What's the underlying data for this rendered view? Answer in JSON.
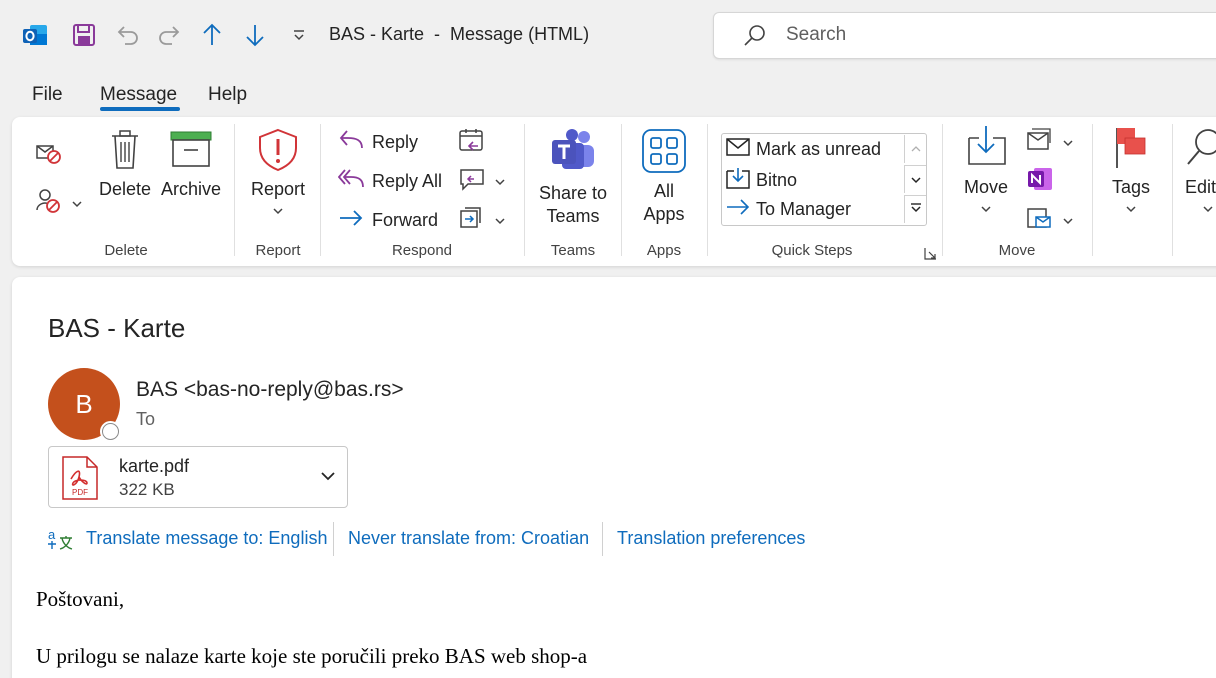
{
  "window": {
    "title": "BAS - Karte  -  Message (HTML)",
    "search_placeholder": "Search"
  },
  "menu": {
    "tabs": [
      {
        "label": "File"
      },
      {
        "label": "Message",
        "active": true
      },
      {
        "label": "Help"
      }
    ]
  },
  "ribbon": {
    "groups": {
      "delete": "Delete",
      "report": "Report",
      "respond": "Respond",
      "teams": "Teams",
      "apps": "Apps",
      "quick_steps": "Quick Steps",
      "move": "Move"
    },
    "buttons": {
      "delete": "Delete",
      "archive": "Archive",
      "report": "Report",
      "reply": "Reply",
      "reply_all": "Reply All",
      "forward": "Forward",
      "share_to_teams_1": "Share to",
      "share_to_teams_2": "Teams",
      "all_apps_1": "All",
      "all_apps_2": "Apps",
      "move": "Move",
      "tags": "Tags",
      "edit": "Edit"
    },
    "quick_steps": [
      {
        "label": "Mark as unread"
      },
      {
        "label": "Bitno"
      },
      {
        "label": "To Manager"
      }
    ]
  },
  "message": {
    "subject": "BAS - Karte",
    "avatar_initial": "B",
    "avatar_color": "#c4501c",
    "sender": "BAS <bas-no-reply@bas.rs>",
    "to_label": "To",
    "attachment": {
      "name": "karte.pdf",
      "size": "322 KB",
      "type_label": "PDF"
    },
    "translation": {
      "translate": "Translate message to: English",
      "never": "Never translate from: Croatian",
      "preferences": "Translation preferences"
    },
    "body": [
      "Poštovani,",
      "U prilogu se nalaze karte koje ste poručili preko BAS web shop-a"
    ]
  },
  "colors": {
    "accent": "#0f6cbd",
    "report_red": "#d13438"
  }
}
